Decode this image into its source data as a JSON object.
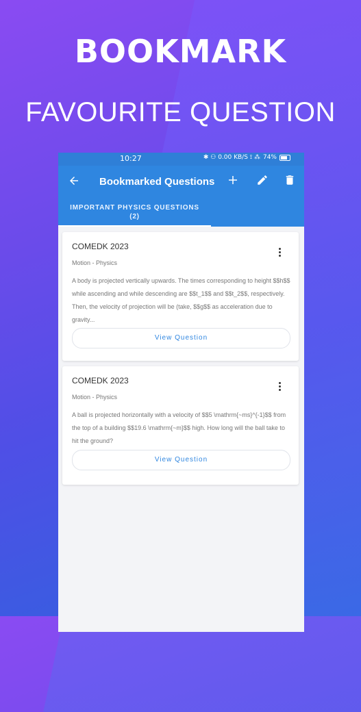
{
  "promo": {
    "headline": "BOOKMARK",
    "subheadline": "FAVOURITE QUESTION"
  },
  "status_bar": {
    "time": "10:27",
    "icons_text": "✱ ⚇ 0.00 KB/S ⟟ ⁂",
    "battery": "74%"
  },
  "app_bar": {
    "back_icon": "arrow-left-icon",
    "title": "Bookmarked Questions",
    "actions": [
      "add-icon",
      "edit-icon",
      "delete-icon"
    ],
    "accent_color": "#2f86e0"
  },
  "tabs": [
    {
      "label_line1": "IMPORTANT PHYSICS QUESTIONS",
      "label_line2": "(2)"
    }
  ],
  "cards": [
    {
      "exam": "COMEDK 2023",
      "topic": "Motion - Physics",
      "text": "A body is projected vertically upwards. The times corresponding to height $$h$$ while ascending and while descending are $$t_1$$ and $$t_2$$, respectively. Then, the velocity of projection will be (take, $$g$$ as acceleration due to gravity...",
      "button": "View Question"
    },
    {
      "exam": "COMEDK 2023",
      "topic": "Motion - Physics",
      "text": "A ball is projected horizontally with a velocity of $$5 \\mathrm{~ms}^{-1}$$ from the top of a building $$19.6 \\mathrm{~m}$$ high. How long will the ball take to hit the ground?",
      "button": "View Question"
    }
  ]
}
